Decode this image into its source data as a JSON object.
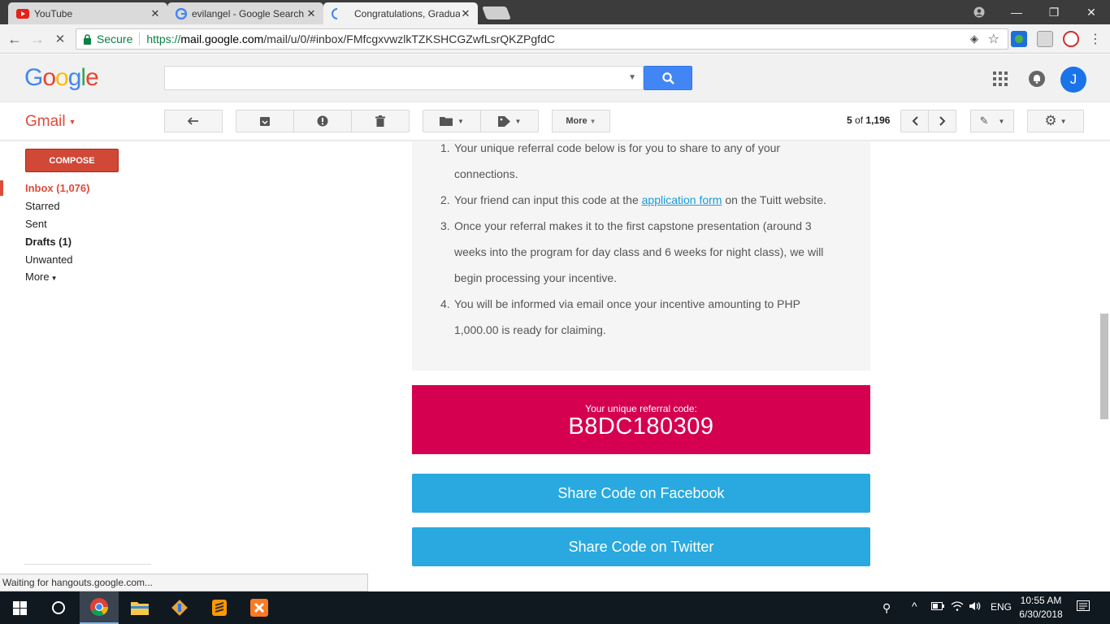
{
  "browser": {
    "tabs": [
      {
        "title": "YouTube",
        "favicon": "youtube-icon"
      },
      {
        "title": "evilangel - Google Search",
        "favicon": "google-icon"
      },
      {
        "title": "Congratulations, Graduate",
        "favicon": "loading-icon"
      }
    ],
    "secure_label": "Secure",
    "url_scheme": "https://",
    "url_domain": "mail.google.com",
    "url_path": "/mail/u/0/#inbox/FMfcgxvwzlkTZKSHCGZwfLsrQKZPgfdC"
  },
  "gmail": {
    "logo": "Google",
    "search_placeholder": "",
    "avatar_letter": "J",
    "app_label": "Gmail",
    "toolbar_more": "More",
    "pager_range": "5",
    "pager_of": "of",
    "pager_total": "1,196",
    "compose": "COMPOSE",
    "nav": {
      "inbox": "Inbox (1,076)",
      "starred": "Starred",
      "sent": "Sent",
      "drafts": "Drafts (1)",
      "unwanted": "Unwanted",
      "more": "More"
    },
    "status_text": "Waiting for hangouts.google.com..."
  },
  "email": {
    "steps": [
      {
        "num": "1.",
        "line1": "Your unique referral code below is for you to share to any of your",
        "line2": "connections."
      },
      {
        "num": "2.",
        "before": "Your friend can input this code at the ",
        "link": "application form",
        "after": " on the Tuitt website."
      },
      {
        "num": "3.",
        "line1": "Once your referral makes it to the first capstone presentation (around 3",
        "line2": "weeks into the program for day class and 6 weeks for night class), we will",
        "line3": "begin processing your incentive."
      },
      {
        "num": "4.",
        "line1": "You will be informed via email once your incentive amounting to PHP",
        "line2": "1,000.00 is ready for claiming."
      }
    ],
    "code_label": "Your unique referral code:",
    "code_value": "B8DC180309",
    "share_facebook": "Share Code on Facebook",
    "share_twitter": "Share Code on Twitter"
  },
  "taskbar": {
    "lang": "ENG",
    "time": "10:55 AM",
    "date": "6/30/2018"
  },
  "colors": {
    "code_bg": "#d5004f",
    "share_bg": "#29a9df",
    "compose_bg": "#d14836",
    "gmail_red": "#dd4b39",
    "search_blue": "#4285f4"
  }
}
